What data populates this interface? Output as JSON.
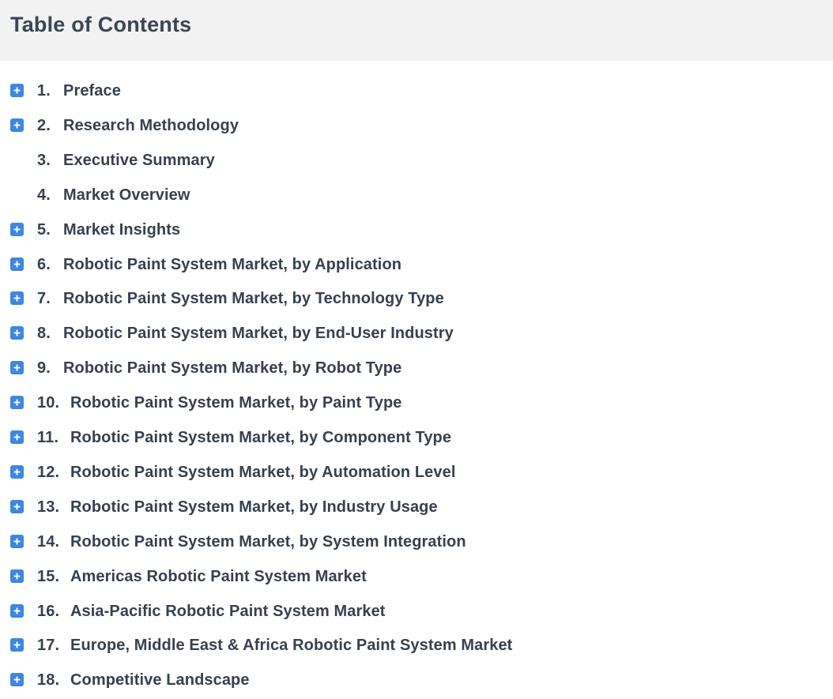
{
  "header": {
    "title": "Table of Contents"
  },
  "toc": {
    "items": [
      {
        "number": "1.",
        "label": "Preface",
        "expandable": true
      },
      {
        "number": "2.",
        "label": "Research Methodology",
        "expandable": true
      },
      {
        "number": "3.",
        "label": "Executive Summary",
        "expandable": false
      },
      {
        "number": "4.",
        "label": "Market Overview",
        "expandable": false
      },
      {
        "number": "5.",
        "label": "Market Insights",
        "expandable": true
      },
      {
        "number": "6.",
        "label": "Robotic Paint System Market, by Application",
        "expandable": true
      },
      {
        "number": "7.",
        "label": "Robotic Paint System Market, by Technology Type",
        "expandable": true
      },
      {
        "number": "8.",
        "label": "Robotic Paint System Market, by End-User Industry",
        "expandable": true
      },
      {
        "number": "9.",
        "label": "Robotic Paint System Market, by Robot Type",
        "expandable": true
      },
      {
        "number": "10.",
        "label": "Robotic Paint System Market, by Paint Type",
        "expandable": true
      },
      {
        "number": "11.",
        "label": "Robotic Paint System Market, by Component Type",
        "expandable": true
      },
      {
        "number": "12.",
        "label": "Robotic Paint System Market, by Automation Level",
        "expandable": true
      },
      {
        "number": "13.",
        "label": "Robotic Paint System Market, by Industry Usage",
        "expandable": true
      },
      {
        "number": "14.",
        "label": "Robotic Paint System Market, by System Integration",
        "expandable": true
      },
      {
        "number": "15.",
        "label": "Americas Robotic Paint System Market",
        "expandable": true
      },
      {
        "number": "16.",
        "label": "Asia-Pacific Robotic Paint System Market",
        "expandable": true
      },
      {
        "number": "17.",
        "label": "Europe, Middle East & Africa Robotic Paint System Market",
        "expandable": true
      },
      {
        "number": "18.",
        "label": "Competitive Landscape",
        "expandable": true
      }
    ],
    "expand_icon": "plus-icon",
    "accent_color": "#3d87e0"
  }
}
